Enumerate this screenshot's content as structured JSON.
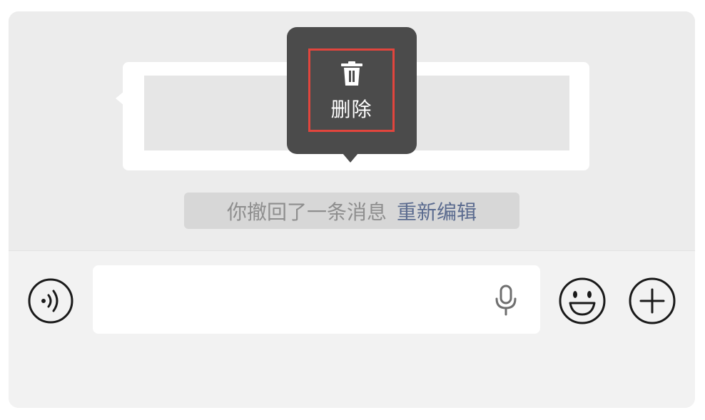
{
  "context_menu": {
    "delete_label": "删除",
    "icon": "trash-icon"
  },
  "system_message": {
    "text": "你撤回了一条消息",
    "link": "重新编辑"
  },
  "input_bar": {
    "voice_icon": "voice-toggle-icon",
    "mic_icon": "microphone-icon",
    "emoji_icon": "emoji-icon",
    "plus_icon": "plus-icon",
    "input_value": ""
  },
  "colors": {
    "menu_bg": "#4b4b4b",
    "highlight": "#e2453d",
    "link": "#5b6b8f"
  }
}
